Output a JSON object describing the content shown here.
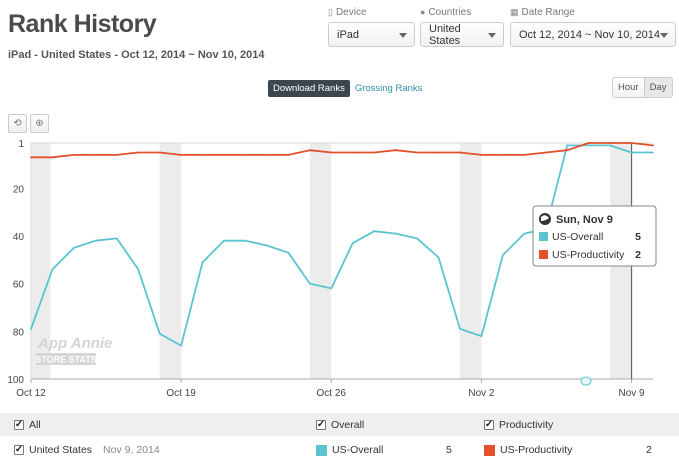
{
  "header": {
    "title": "Rank History",
    "subtitle": "iPad - United States - Oct 12, 2014 ~ Nov 10, 2014"
  },
  "filters": {
    "device": {
      "label": "Device",
      "value": "iPad",
      "icon": "device-icon"
    },
    "countries": {
      "label": "Countries",
      "value": "United States",
      "icon": "globe-icon"
    },
    "date_range": {
      "label": "Date Range",
      "value": "Oct 12, 2014 ~ Nov 10, 2014",
      "icon": "calendar-icon"
    }
  },
  "rank_type": {
    "download": "Download Ranks",
    "grossing": "Grossing Ranks",
    "active": "download"
  },
  "period": {
    "hour": "Hour",
    "day": "Day",
    "active": "day"
  },
  "tools": {
    "reset_icon": "reset-zoom-icon",
    "zoom_icon": "zoom-icon"
  },
  "watermark": {
    "line1": "App Annie",
    "line2": "STORE STATS"
  },
  "tooltip": {
    "date": "Sun, Nov 9",
    "rows": [
      {
        "name": "US-Overall",
        "value": "5",
        "color": "#5bc4d1"
      },
      {
        "name": "US-Productivity",
        "value": "2",
        "color": "#e2512e"
      }
    ]
  },
  "legend": {
    "all_label": "All",
    "overall_label": "Overall",
    "productivity_label": "Productivity",
    "country_label": "United States",
    "country_date": "Nov 9, 2014",
    "series": [
      {
        "name": "US-Overall",
        "value": "5",
        "color": "#5bc4d1"
      },
      {
        "name": "US-Productivity",
        "value": "2",
        "color": "#e2512e"
      }
    ]
  },
  "chart_data": {
    "type": "line",
    "ylabel": "",
    "xlabel": "",
    "ylim": [
      1,
      100
    ],
    "y_reversed": true,
    "y_ticks": [
      "1",
      "20",
      "40",
      "60",
      "80",
      "100"
    ],
    "x_tick_labels": [
      "Oct 12",
      "Oct 19",
      "Oct 26",
      "Nov 2",
      "Nov 9"
    ],
    "x": [
      "Oct 12",
      "Oct 13",
      "Oct 14",
      "Oct 15",
      "Oct 16",
      "Oct 17",
      "Oct 18",
      "Oct 19",
      "Oct 20",
      "Oct 21",
      "Oct 22",
      "Oct 23",
      "Oct 24",
      "Oct 25",
      "Oct 26",
      "Oct 27",
      "Oct 28",
      "Oct 29",
      "Oct 30",
      "Oct 31",
      "Nov 1",
      "Nov 2",
      "Nov 3",
      "Nov 4",
      "Nov 5",
      "Nov 6",
      "Nov 7",
      "Nov 8",
      "Nov 9",
      "Nov 10"
    ],
    "series": [
      {
        "name": "US-Overall",
        "color": "#5bc4d1",
        "values": [
          79,
          54,
          45,
          42,
          41,
          54,
          81,
          86,
          51,
          42,
          42,
          44,
          47,
          60,
          62,
          43,
          38,
          39,
          41,
          49,
          79,
          82,
          48,
          39,
          37,
          2,
          2,
          2,
          5,
          5
        ]
      },
      {
        "name": "US-Productivity",
        "color": "#e2512e",
        "values": [
          7,
          7,
          6,
          6,
          6,
          5,
          5,
          6,
          6,
          6,
          6,
          6,
          6,
          4,
          5,
          5,
          5,
          4,
          5,
          5,
          5,
          6,
          6,
          6,
          5,
          4,
          1,
          1,
          1,
          2
        ]
      }
    ],
    "weekend_shading": true,
    "highlighted": "Nov 9"
  }
}
